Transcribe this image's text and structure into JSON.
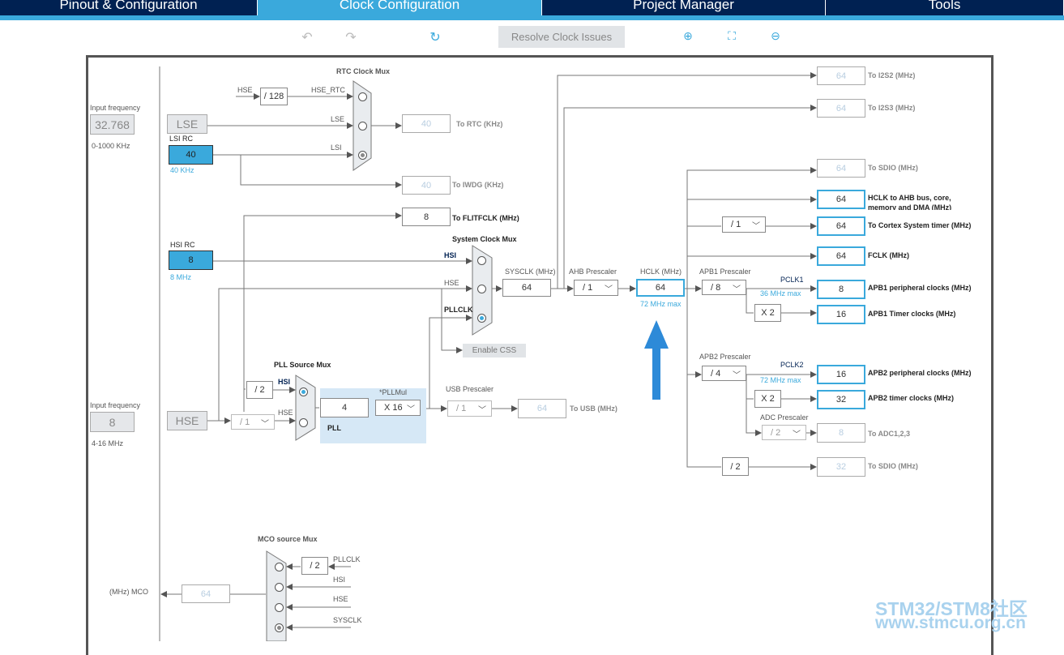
{
  "tabs": [
    {
      "label": "Pinout & Configuration"
    },
    {
      "label": "Clock Configuration",
      "active": true
    },
    {
      "label": "Project Manager"
    },
    {
      "label": "Tools"
    }
  ],
  "toolbar": {
    "undo_icon": "undo-icon",
    "redo_icon": "redo-icon",
    "refresh_icon": "refresh-icon",
    "resolve": "Resolve Clock Issues",
    "zoom_in_icon": "zoom-in-icon",
    "fit_icon": "fit-icon",
    "zoom_out_icon": "zoom-out-icon"
  },
  "colors": {
    "accent": "#3aa9dc",
    "tab_bg": "#002152"
  },
  "lse_input": {
    "label": "Input frequency",
    "value": "32.768",
    "range": "0-1000 KHz",
    "name": "LSE"
  },
  "lsi": {
    "label": "LSI RC",
    "value": "40",
    "unit": "40 KHz"
  },
  "hsi": {
    "label": "HSI RC",
    "value": "8",
    "unit": "8 MHz"
  },
  "hse_input": {
    "label": "Input frequency",
    "value": "8",
    "range": "4-16 MHz",
    "name": "HSE"
  },
  "rtc": {
    "title": "RTC Clock Mux",
    "hse": "HSE",
    "div": "/ 128",
    "hse_rtc": "HSE_RTC",
    "lse": "LSE",
    "lsi": "LSI",
    "out": "40",
    "out_label": "To RTC (KHz)"
  },
  "iwdg": {
    "value": "40",
    "label": "To IWDG (KHz)"
  },
  "flitf": {
    "value": "8",
    "label": "To FLITFCLK (MHz)"
  },
  "sysmux": {
    "title": "System Clock Mux",
    "hsi": "HSI",
    "hse": "HSE",
    "pllclk": "PLLCLK",
    "css": "Enable CSS"
  },
  "sysclk": {
    "label": "SYSCLK (MHz)",
    "value": "64"
  },
  "ahb": {
    "label": "AHB Prescaler",
    "value": "/ 1"
  },
  "hclk": {
    "label": "HCLK (MHz)",
    "value": "64",
    "max": "72 MHz max"
  },
  "pllsrc": {
    "title": "PLL Source Mux",
    "hsi": "HSI",
    "hse": "HSE",
    "hsi_div": "/ 2",
    "hse_div": "/ 1"
  },
  "pll": {
    "value": "4",
    "mul_label": "*PLLMul",
    "mul": "X 16",
    "label": "PLL"
  },
  "usb": {
    "label": "USB Prescaler",
    "div": "/ 1",
    "value": "64",
    "out_label": "To USB (MHz)"
  },
  "outputs": {
    "i2s2": {
      "value": "64",
      "label": "To I2S2 (MHz)"
    },
    "i2s3": {
      "value": "64",
      "label": "To I2S3 (MHz)"
    },
    "sdio1": {
      "value": "64",
      "label": "To SDIO (MHz)"
    },
    "ahb": {
      "value": "64",
      "label": "HCLK to AHB bus, core, memory and DMA (MHz)"
    },
    "cortex": {
      "div": "/ 1",
      "value": "64",
      "label": "To Cortex System timer (MHz)"
    },
    "fclk": {
      "value": "64",
      "label": "FCLK (MHz)"
    },
    "apb1": {
      "prescaler_label": "APB1 Prescaler",
      "div": "/ 8",
      "pclk": "PCLK1",
      "max": "36 MHz max",
      "value": "8",
      "label": "APB1 peripheral clocks (MHz)",
      "tmul": "X 2",
      "timer": "16",
      "timer_label": "APB1 Timer clocks (MHz)"
    },
    "apb2": {
      "prescaler_label": "APB2 Prescaler",
      "div": "/ 4",
      "pclk": "PCLK2",
      "max": "72 MHz max",
      "value": "16",
      "label": "APB2 peripheral clocks (MHz)",
      "tmul": "X 2",
      "timer": "32",
      "timer_label": "APB2 timer clocks (MHz)"
    },
    "adc": {
      "prescaler_label": "ADC Prescaler",
      "div": "/ 2",
      "value": "8",
      "label": "To ADC1,2,3"
    },
    "sdio2": {
      "div": "/ 2",
      "value": "32",
      "label": "To SDIO (MHz)"
    }
  },
  "mco": {
    "title": "MCO source Mux",
    "div": "/ 2",
    "pllclk": "PLLCLK",
    "hsi": "HSI",
    "hse": "HSE",
    "sysclk": "SYSCLK",
    "label": "(MHz) MCO",
    "value": "64"
  },
  "watermark": {
    "line1": "STM32/STM8社区",
    "line2": "www.stmcu.org.cn"
  }
}
